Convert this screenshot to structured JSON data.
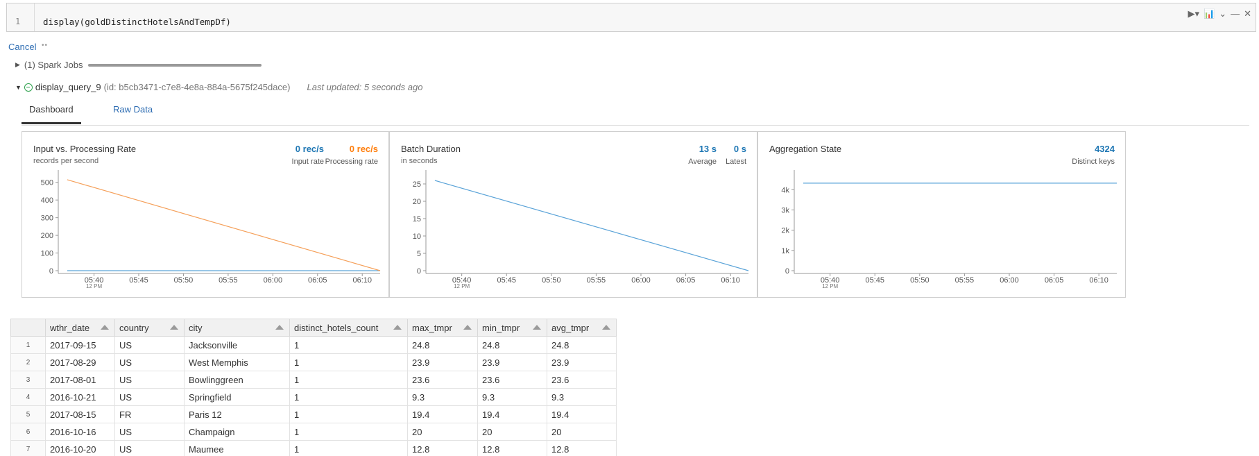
{
  "cell": {
    "line_number": "1",
    "code": "display(goldDistinctHotelsAndTempDf)",
    "toolbar": {
      "run": "▶▾",
      "chart": "📊",
      "collapse": "⌄",
      "minimize": "—",
      "close": "✕"
    }
  },
  "cancel_label": "Cancel",
  "cancel_dots": "••",
  "spark_jobs": "(1) Spark Jobs",
  "query": {
    "name": "display_query_9",
    "id": "(id: b5cb3471-c7e8-4e8a-884a-5675f245dace)",
    "updated": "Last updated: 5 seconds ago"
  },
  "tabs": {
    "dashboard": "Dashboard",
    "raw": "Raw Data"
  },
  "colors": {
    "blue": "#1f77b4",
    "orange": "#ff7f0e",
    "line_blue": "#5aa3d8",
    "line_orange": "#f5a05a"
  },
  "panels": {
    "rate": {
      "title": "Input vs. Processing Rate",
      "subtitle": "records per second",
      "m1_value": "0 rec/s",
      "m1_label": "Input rate",
      "m2_value": "0 rec/s",
      "m2_label": "Processing rate"
    },
    "batch": {
      "title": "Batch Duration",
      "subtitle": "in seconds",
      "m1_value": "13 s",
      "m1_label": "Average",
      "m2_value": "0 s",
      "m2_label": "Latest"
    },
    "agg": {
      "title": "Aggregation State",
      "m1_value": "4324",
      "m1_label": "Distinct keys"
    }
  },
  "chart_data": [
    {
      "type": "line",
      "x_ticks": [
        "05:40",
        "05:45",
        "05:50",
        "05:55",
        "06:00",
        "06:05",
        "06:10"
      ],
      "x_tick_sub": "12 PM",
      "y_ticks": [
        "0",
        "100",
        "200",
        "300",
        "400",
        "500"
      ],
      "ylim": [
        0,
        550
      ],
      "x": [
        "05:37",
        "06:12"
      ],
      "series": [
        {
          "name": "Input rate",
          "color": "#5aa3d8",
          "values": [
            0,
            0
          ]
        },
        {
          "name": "Processing rate",
          "color": "#f5a05a",
          "values": [
            515,
            0
          ]
        }
      ]
    },
    {
      "type": "line",
      "x_ticks": [
        "05:40",
        "05:45",
        "05:50",
        "05:55",
        "06:00",
        "06:05",
        "06:10"
      ],
      "x_tick_sub": "12 PM",
      "y_ticks": [
        "0",
        "5",
        "10",
        "15",
        "20",
        "25"
      ],
      "ylim": [
        0,
        28
      ],
      "x": [
        "05:37",
        "06:12"
      ],
      "series": [
        {
          "name": "Batch Duration",
          "color": "#5aa3d8",
          "values": [
            26,
            0
          ]
        }
      ]
    },
    {
      "type": "line",
      "x_ticks": [
        "05:40",
        "05:45",
        "05:50",
        "05:55",
        "06:00",
        "06:05",
        "06:10"
      ],
      "x_tick_sub": "12 PM",
      "y_ticks": [
        "0",
        "1k",
        "2k",
        "3k",
        "4k"
      ],
      "ylim": [
        0,
        4800
      ],
      "x": [
        "05:37",
        "06:12"
      ],
      "series": [
        {
          "name": "Distinct keys",
          "color": "#5aa3d8",
          "values": [
            4324,
            4324
          ]
        }
      ]
    }
  ],
  "table": {
    "columns": [
      "wthr_date",
      "country",
      "city",
      "distinct_hotels_count",
      "max_tmpr",
      "min_tmpr",
      "avg_tmpr"
    ],
    "rows": [
      [
        "1",
        "2017-09-15",
        "US",
        "Jacksonville",
        "1",
        "24.8",
        "24.8",
        "24.8"
      ],
      [
        "2",
        "2017-08-29",
        "US",
        "West Memphis",
        "1",
        "23.9",
        "23.9",
        "23.9"
      ],
      [
        "3",
        "2017-08-01",
        "US",
        "Bowlinggreen",
        "1",
        "23.6",
        "23.6",
        "23.6"
      ],
      [
        "4",
        "2016-10-21",
        "US",
        "Springfield",
        "1",
        "9.3",
        "9.3",
        "9.3"
      ],
      [
        "5",
        "2017-08-15",
        "FR",
        "Paris 12",
        "1",
        "19.4",
        "19.4",
        "19.4"
      ],
      [
        "6",
        "2016-10-16",
        "US",
        "Champaign",
        "1",
        "20",
        "20",
        "20"
      ],
      [
        "7",
        "2016-10-20",
        "US",
        "Maumee",
        "1",
        "12.8",
        "12.8",
        "12.8"
      ]
    ]
  }
}
